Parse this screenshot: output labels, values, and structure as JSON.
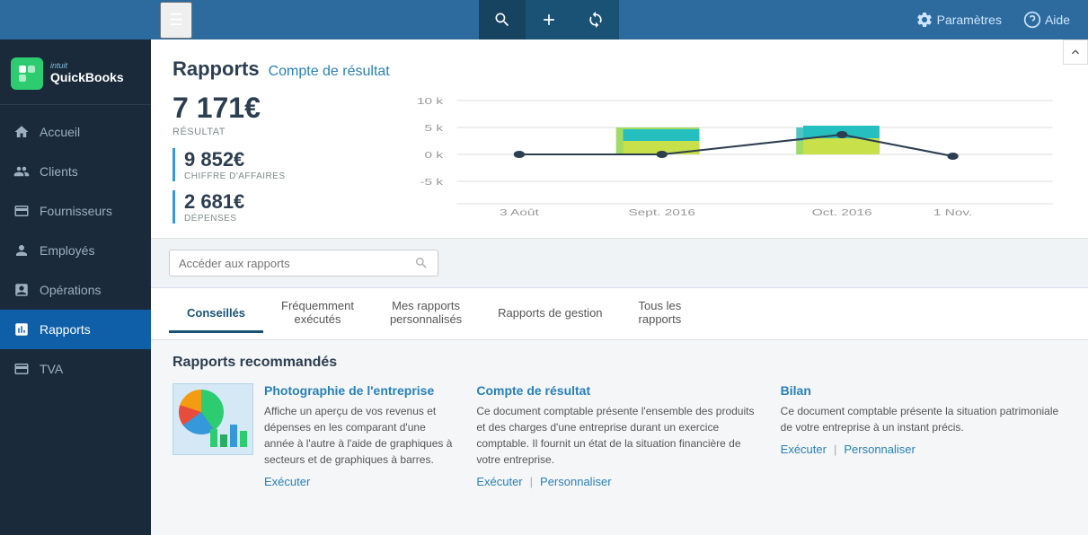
{
  "topNav": {
    "hamburger": "☰",
    "buttons": [
      {
        "icon": "🔍",
        "label": "search",
        "active": true
      },
      {
        "icon": "+",
        "label": "add",
        "active": false
      },
      {
        "icon": "⟳",
        "label": "sync",
        "active": false
      }
    ],
    "rightButtons": [
      {
        "icon": "⚙",
        "label": "Paramètres"
      },
      {
        "icon": "?",
        "label": "Aide"
      }
    ]
  },
  "sidebar": {
    "logo": "quickbooks",
    "items": [
      {
        "label": "Accueil",
        "icon": "home",
        "active": false
      },
      {
        "label": "Clients",
        "icon": "clients",
        "active": false
      },
      {
        "label": "Fournisseurs",
        "icon": "suppliers",
        "active": false
      },
      {
        "label": "Employés",
        "icon": "employees",
        "active": false
      },
      {
        "label": "Opérations",
        "icon": "operations",
        "active": false
      },
      {
        "label": "Rapports",
        "icon": "reports",
        "active": true
      },
      {
        "label": "TVA",
        "icon": "tva",
        "active": false
      }
    ]
  },
  "header": {
    "title": "Rapports",
    "subtitle": "Compte de résultat"
  },
  "stats": {
    "main": {
      "value": "7 171€",
      "label": "RÉSULTAT"
    },
    "secondary1": {
      "value": "9 852€",
      "label": "CHIFFRE D'AFFAIRES"
    },
    "secondary2": {
      "value": "2 681€",
      "label": "DÉPENSES"
    }
  },
  "chart": {
    "xLabels": [
      "3 Août",
      "Sept. 2016",
      "Oct. 2016",
      "1 Nov."
    ],
    "yLabels": [
      "10 k",
      "5 k",
      "0 k",
      "-5 k"
    ]
  },
  "search": {
    "placeholder": "Accéder aux rapports"
  },
  "tabs": [
    {
      "label": "Conseillés",
      "active": true
    },
    {
      "label": "Fréquemment\nexécutés",
      "active": false
    },
    {
      "label": "Mes rapports\npersonnalisés",
      "active": false
    },
    {
      "label": "Rapports de gestion",
      "active": false
    },
    {
      "label": "Tous les\nrapports",
      "active": false
    }
  ],
  "recommendedSection": {
    "title": "Rapports recommandés",
    "reports": [
      {
        "title": "Photographie de l'entreprise",
        "desc": "Affiche un aperçu de vos revenus et dépenses en les comparant d'une année à l'autre à l'aide de graphiques à secteurs et de graphiques à barres.",
        "actions": [
          "Exécuter"
        ],
        "hasImage": true
      },
      {
        "title": "Compte de résultat",
        "desc": "Ce document comptable présente l'ensemble des produits et des charges d'une entreprise durant un exercice comptable. Il fournit un état de la situation financière de votre entreprise.",
        "actions": [
          "Exécuter",
          "Personnaliser"
        ],
        "hasImage": false
      },
      {
        "title": "Bilan",
        "desc": "Ce document comptable présente la situation patrimoniale de votre entreprise à un instant précis.",
        "actions": [
          "Exécuter",
          "Personnaliser"
        ],
        "hasImage": false
      }
    ]
  }
}
